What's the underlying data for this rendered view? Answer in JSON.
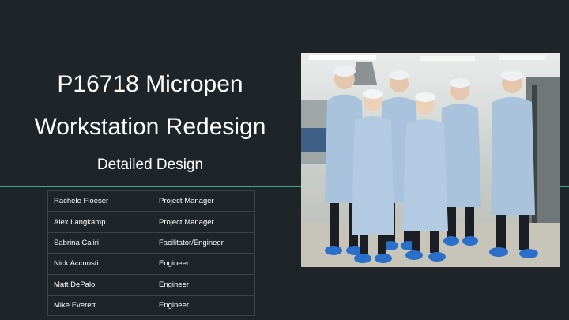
{
  "slide": {
    "title_line1": "P16718 Micropen",
    "title_line2": "Workstation Redesign",
    "subtitle": "Detailed Design",
    "accent_color": "#3aa883",
    "background_color": "#1f2428"
  },
  "team": [
    {
      "name": "Rachele Floeser",
      "role": "Project Manager"
    },
    {
      "name": "Alex Langkamp",
      "role": "Project Manager"
    },
    {
      "name": "Sabrina Caliri",
      "role": "Facilitator/Engineer"
    },
    {
      "name": "Nick Accuosti",
      "role": "Engineer"
    },
    {
      "name": "Matt DePalo",
      "role": "Engineer"
    },
    {
      "name": "Mike Everett",
      "role": "Engineer"
    }
  ],
  "photo": {
    "subject": "team-photo",
    "gown_color": "#a9c3dc",
    "shoe_cover_color": "#2a6fc9"
  }
}
